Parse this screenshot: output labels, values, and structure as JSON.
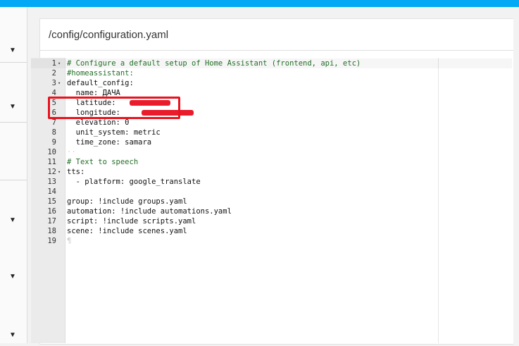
{
  "header": {
    "file_path": "/config/configuration.yaml",
    "accent_color": "#03a9f4"
  },
  "sidebar": {
    "toggle_icon": "caret-down-icon",
    "toggles": [
      "▼",
      "▼",
      "▼",
      "▼",
      "▼",
      "▼"
    ]
  },
  "editor": {
    "lines": [
      {
        "num": "1",
        "fold": "▾",
        "text": "# Configure a default setup of Home Assistant (frontend, api, etc)",
        "type": "comment",
        "active": true
      },
      {
        "num": "2",
        "fold": "",
        "text": "#homeassistant:",
        "type": "comment"
      },
      {
        "num": "3",
        "fold": "▾",
        "text": "default_config:",
        "type": "key"
      },
      {
        "num": "4",
        "fold": "",
        "text": "  name: ДАЧА",
        "type": "key"
      },
      {
        "num": "5",
        "fold": "",
        "text": "  latitude: ",
        "type": "key",
        "redacted": true
      },
      {
        "num": "6",
        "fold": "",
        "text": "  longitude: ",
        "type": "key",
        "redacted": true
      },
      {
        "num": "7",
        "fold": "",
        "text": "  elevation: 0",
        "type": "key"
      },
      {
        "num": "8",
        "fold": "",
        "text": "  unit_system: metric",
        "type": "key"
      },
      {
        "num": "9",
        "fold": "",
        "text": "  time_zone: samara",
        "type": "key"
      },
      {
        "num": "10",
        "fold": "",
        "text": "··",
        "type": "invisible"
      },
      {
        "num": "11",
        "fold": "",
        "text": "# Text to speech",
        "type": "comment"
      },
      {
        "num": "12",
        "fold": "▾",
        "text": "tts:",
        "type": "key"
      },
      {
        "num": "13",
        "fold": "",
        "text": "  - platform: google_translate",
        "type": "key"
      },
      {
        "num": "14",
        "fold": "",
        "text": "",
        "type": "key"
      },
      {
        "num": "15",
        "fold": "",
        "text": "group: !include groups.yaml",
        "type": "key"
      },
      {
        "num": "16",
        "fold": "",
        "text": "automation: !include automations.yaml",
        "type": "key"
      },
      {
        "num": "17",
        "fold": "",
        "text": "script: !include scripts.yaml",
        "type": "key"
      },
      {
        "num": "18",
        "fold": "",
        "text": "scene: !include scenes.yaml",
        "type": "key"
      },
      {
        "num": "19",
        "fold": "",
        "text": "¶",
        "type": "invisible"
      }
    ]
  },
  "annotation": {
    "highlight_color": "#e8131f",
    "redaction_color": "#ea1c2c"
  }
}
